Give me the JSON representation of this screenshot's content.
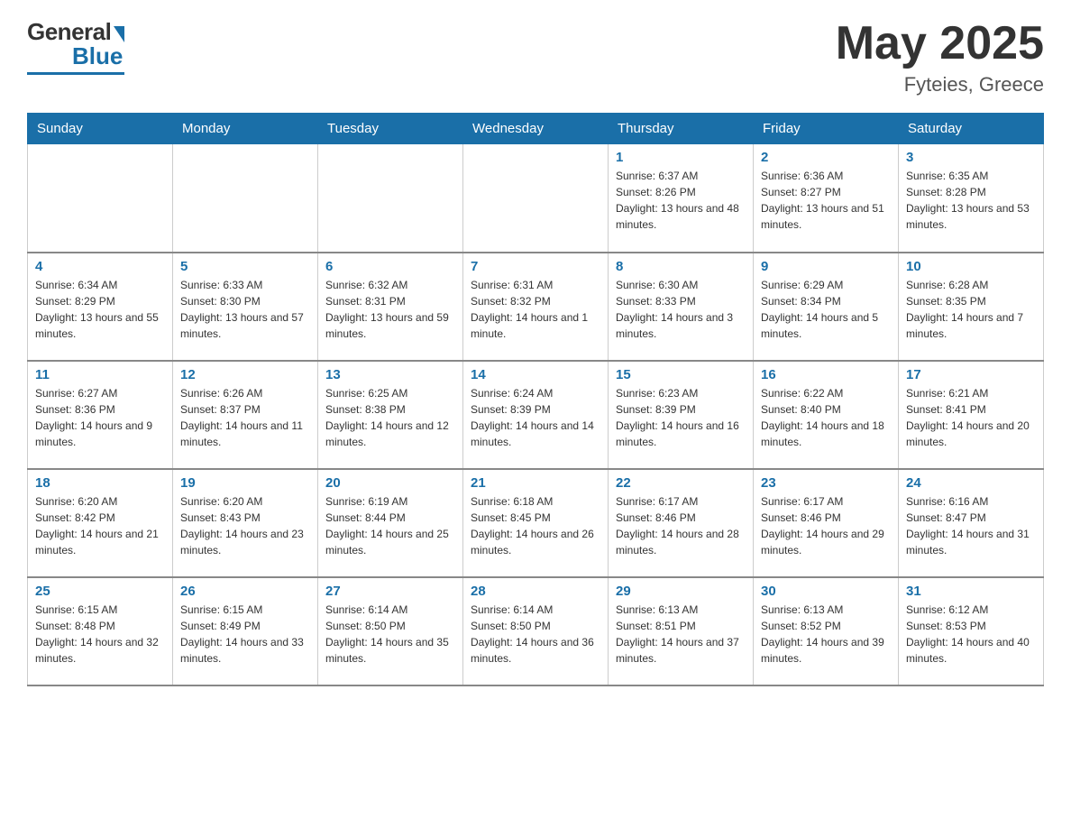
{
  "logo": {
    "general": "General",
    "blue": "Blue"
  },
  "header": {
    "month_year": "May 2025",
    "location": "Fyteies, Greece"
  },
  "days_of_week": [
    "Sunday",
    "Monday",
    "Tuesday",
    "Wednesday",
    "Thursday",
    "Friday",
    "Saturday"
  ],
  "weeks": [
    [
      {
        "day": "",
        "info": ""
      },
      {
        "day": "",
        "info": ""
      },
      {
        "day": "",
        "info": ""
      },
      {
        "day": "",
        "info": ""
      },
      {
        "day": "1",
        "info": "Sunrise: 6:37 AM\nSunset: 8:26 PM\nDaylight: 13 hours and 48 minutes."
      },
      {
        "day": "2",
        "info": "Sunrise: 6:36 AM\nSunset: 8:27 PM\nDaylight: 13 hours and 51 minutes."
      },
      {
        "day": "3",
        "info": "Sunrise: 6:35 AM\nSunset: 8:28 PM\nDaylight: 13 hours and 53 minutes."
      }
    ],
    [
      {
        "day": "4",
        "info": "Sunrise: 6:34 AM\nSunset: 8:29 PM\nDaylight: 13 hours and 55 minutes."
      },
      {
        "day": "5",
        "info": "Sunrise: 6:33 AM\nSunset: 8:30 PM\nDaylight: 13 hours and 57 minutes."
      },
      {
        "day": "6",
        "info": "Sunrise: 6:32 AM\nSunset: 8:31 PM\nDaylight: 13 hours and 59 minutes."
      },
      {
        "day": "7",
        "info": "Sunrise: 6:31 AM\nSunset: 8:32 PM\nDaylight: 14 hours and 1 minute."
      },
      {
        "day": "8",
        "info": "Sunrise: 6:30 AM\nSunset: 8:33 PM\nDaylight: 14 hours and 3 minutes."
      },
      {
        "day": "9",
        "info": "Sunrise: 6:29 AM\nSunset: 8:34 PM\nDaylight: 14 hours and 5 minutes."
      },
      {
        "day": "10",
        "info": "Sunrise: 6:28 AM\nSunset: 8:35 PM\nDaylight: 14 hours and 7 minutes."
      }
    ],
    [
      {
        "day": "11",
        "info": "Sunrise: 6:27 AM\nSunset: 8:36 PM\nDaylight: 14 hours and 9 minutes."
      },
      {
        "day": "12",
        "info": "Sunrise: 6:26 AM\nSunset: 8:37 PM\nDaylight: 14 hours and 11 minutes."
      },
      {
        "day": "13",
        "info": "Sunrise: 6:25 AM\nSunset: 8:38 PM\nDaylight: 14 hours and 12 minutes."
      },
      {
        "day": "14",
        "info": "Sunrise: 6:24 AM\nSunset: 8:39 PM\nDaylight: 14 hours and 14 minutes."
      },
      {
        "day": "15",
        "info": "Sunrise: 6:23 AM\nSunset: 8:39 PM\nDaylight: 14 hours and 16 minutes."
      },
      {
        "day": "16",
        "info": "Sunrise: 6:22 AM\nSunset: 8:40 PM\nDaylight: 14 hours and 18 minutes."
      },
      {
        "day": "17",
        "info": "Sunrise: 6:21 AM\nSunset: 8:41 PM\nDaylight: 14 hours and 20 minutes."
      }
    ],
    [
      {
        "day": "18",
        "info": "Sunrise: 6:20 AM\nSunset: 8:42 PM\nDaylight: 14 hours and 21 minutes."
      },
      {
        "day": "19",
        "info": "Sunrise: 6:20 AM\nSunset: 8:43 PM\nDaylight: 14 hours and 23 minutes."
      },
      {
        "day": "20",
        "info": "Sunrise: 6:19 AM\nSunset: 8:44 PM\nDaylight: 14 hours and 25 minutes."
      },
      {
        "day": "21",
        "info": "Sunrise: 6:18 AM\nSunset: 8:45 PM\nDaylight: 14 hours and 26 minutes."
      },
      {
        "day": "22",
        "info": "Sunrise: 6:17 AM\nSunset: 8:46 PM\nDaylight: 14 hours and 28 minutes."
      },
      {
        "day": "23",
        "info": "Sunrise: 6:17 AM\nSunset: 8:46 PM\nDaylight: 14 hours and 29 minutes."
      },
      {
        "day": "24",
        "info": "Sunrise: 6:16 AM\nSunset: 8:47 PM\nDaylight: 14 hours and 31 minutes."
      }
    ],
    [
      {
        "day": "25",
        "info": "Sunrise: 6:15 AM\nSunset: 8:48 PM\nDaylight: 14 hours and 32 minutes."
      },
      {
        "day": "26",
        "info": "Sunrise: 6:15 AM\nSunset: 8:49 PM\nDaylight: 14 hours and 33 minutes."
      },
      {
        "day": "27",
        "info": "Sunrise: 6:14 AM\nSunset: 8:50 PM\nDaylight: 14 hours and 35 minutes."
      },
      {
        "day": "28",
        "info": "Sunrise: 6:14 AM\nSunset: 8:50 PM\nDaylight: 14 hours and 36 minutes."
      },
      {
        "day": "29",
        "info": "Sunrise: 6:13 AM\nSunset: 8:51 PM\nDaylight: 14 hours and 37 minutes."
      },
      {
        "day": "30",
        "info": "Sunrise: 6:13 AM\nSunset: 8:52 PM\nDaylight: 14 hours and 39 minutes."
      },
      {
        "day": "31",
        "info": "Sunrise: 6:12 AM\nSunset: 8:53 PM\nDaylight: 14 hours and 40 minutes."
      }
    ]
  ]
}
